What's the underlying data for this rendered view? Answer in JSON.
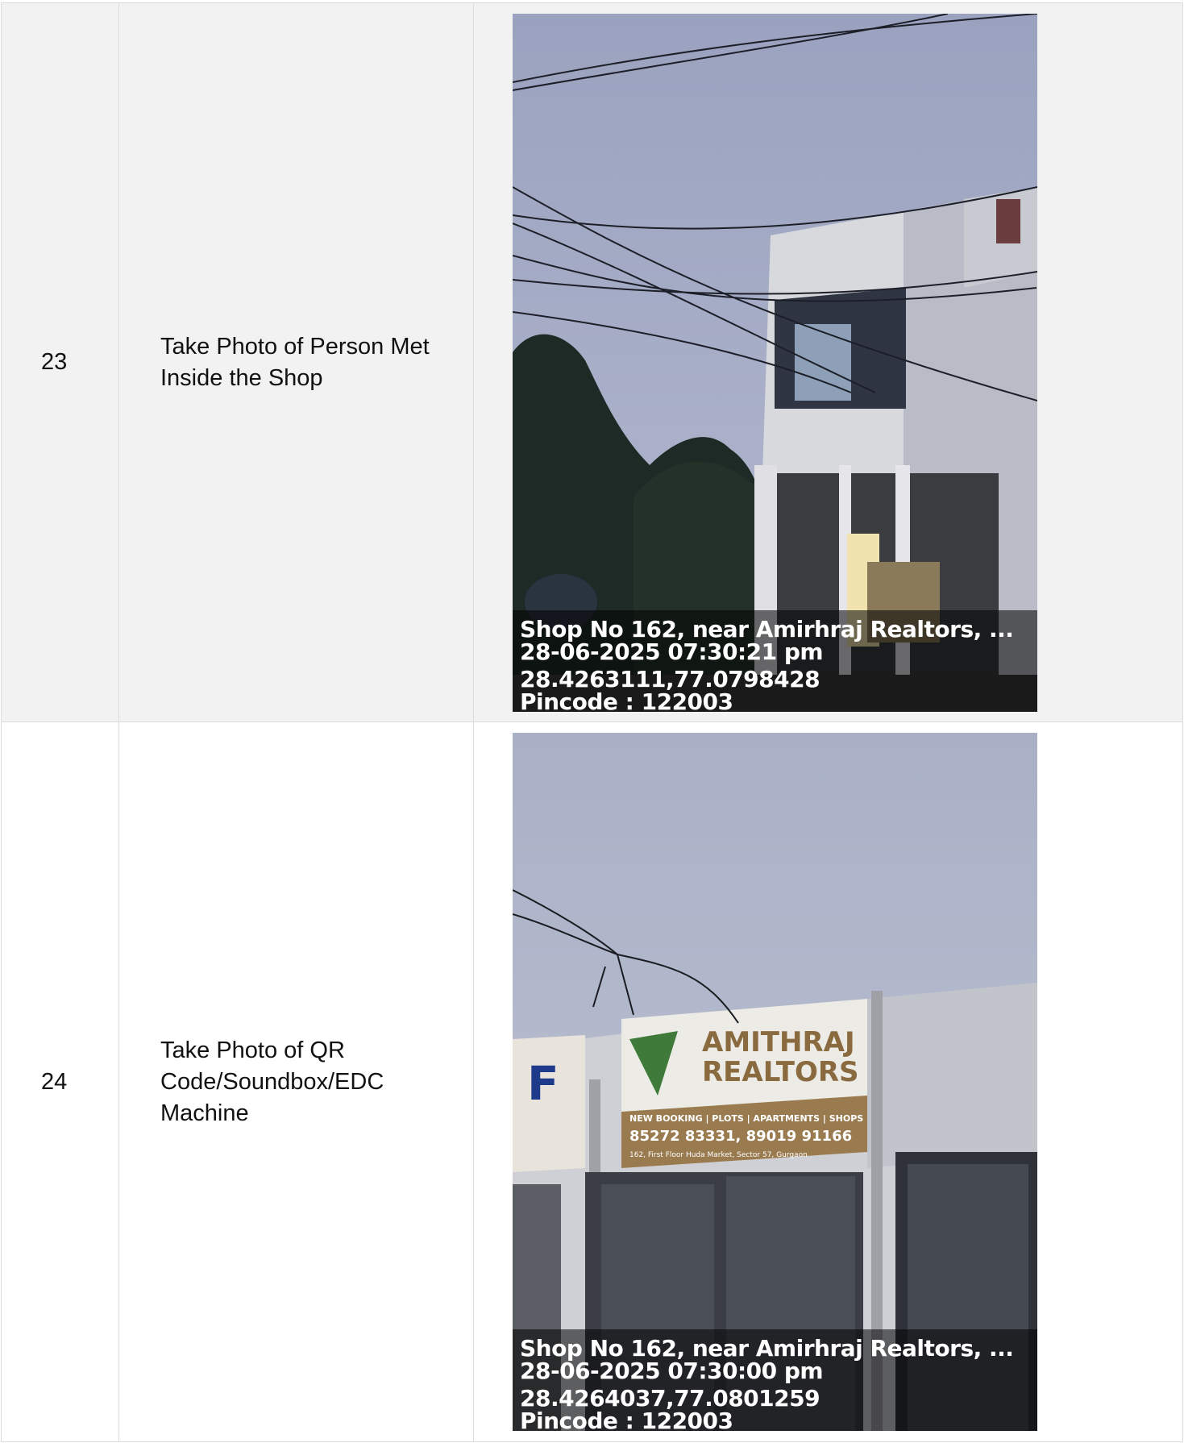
{
  "rows": [
    {
      "number": "23",
      "description": "Take Photo of Person Met Inside the Shop",
      "photo": {
        "subject": "two-storey-white-shop-building-evening",
        "stamp": {
          "address": "Shop No 162, near Amirhraj Realtors, ...",
          "datetime": "28-06-2025 07:30:21 pm",
          "coordinates": "28.4263111,77.0798428",
          "pincode": "Pincode : 122003"
        }
      }
    },
    {
      "number": "24",
      "description": "Take Photo of QR Code/Soundbox/EDC Machine",
      "photo": {
        "subject": "shopfront-with-realtor-signboard",
        "sign": {
          "line1": "AMITHRAJ",
          "line2": "REALTORS",
          "services": "NEW BOOKING | PLOTS | APARTMENTS | SHOPS",
          "phones": "85272 83331, 89019 91166",
          "address": "162, First Floor Huda Market, Sector 57, Gurgaon"
        },
        "stamp": {
          "address": "Shop No 162, near Amirhraj Realtors, ...",
          "datetime": "28-06-2025 07:30:00 pm",
          "coordinates": "28.4264037,77.0801259",
          "pincode": "Pincode : 122003"
        }
      }
    }
  ],
  "colors": {
    "row_alt_bg": "#f2f2f2",
    "border": "#dcdcdc",
    "sky": "#a9b0c6",
    "wall": "#d9dade"
  }
}
